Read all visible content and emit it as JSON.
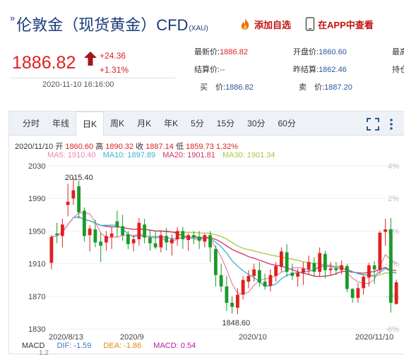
{
  "header": {
    "title": "伦敦金（现货黄金）CFD",
    "title_code": "(XAU)",
    "add_watchlist_label": "添加自选",
    "open_app_label": "在APP中查看"
  },
  "quote": {
    "price": "1886.82",
    "change": "+24.36",
    "change_pct": "+1.31%",
    "datetime": "2020-11-10 16:16:00",
    "fields": [
      {
        "label": "最新价:",
        "value": "1886.82",
        "tone": "red"
      },
      {
        "label": "开盘价:",
        "value": "1860.60",
        "tone": "blue"
      },
      {
        "label": "最高",
        "value": "",
        "tone": "red"
      },
      {
        "label": "结算价:",
        "value": "--",
        "tone": "blue"
      },
      {
        "label": "昨结算:",
        "value": "1862.46",
        "tone": "blue"
      },
      {
        "label": "持仓",
        "value": "",
        "tone": "red"
      },
      {
        "label": "买　价:",
        "value": "1886.82",
        "tone": "blue"
      },
      {
        "label": "卖　价:",
        "value": "1887.20",
        "tone": "blue"
      }
    ]
  },
  "tabs": [
    "分时",
    "年线",
    "日K",
    "周K",
    "月K",
    "年K",
    "5分",
    "15分",
    "30分",
    "60分"
  ],
  "active_tab": "日K",
  "ohlc": {
    "date": "2020/11/10",
    "open_label": "开",
    "open": "1860.60",
    "high_label": "高",
    "high": "1890.32",
    "close_label": "收",
    "close": "1887.14",
    "low_label": "低",
    "low": "1859.73",
    "pct": "1.32%"
  },
  "ma": {
    "ma5": "MA5: 1910.40",
    "ma10": "MA10: 1897.89",
    "ma20": "MA20: 1901.81",
    "ma30": "MA30: 1901.34"
  },
  "macd": {
    "name": "MACD",
    "dif": "DIF: -1.59",
    "dea": "DEA: -1.86",
    "macd": "MACD: 0.54",
    "next_tick": "1.2"
  },
  "colors": {
    "up": "#e02020",
    "down": "#1a9a2a",
    "ma5": "#e88aa8",
    "ma10": "#3ab0d0",
    "ma20": "#d23060",
    "ma30": "#a8c840",
    "title": "#1a3a7a"
  },
  "chart_data": {
    "type": "candlestick",
    "y_ticks": [
      "2030",
      "1990",
      "1950",
      "1910",
      "1870",
      "1830"
    ],
    "y_range": [
      1830,
      2030
    ],
    "pct_ticks": [
      "4%",
      "2%",
      "0%",
      "-2%",
      "-4%",
      "-6%"
    ],
    "x_labels": [
      "2020/8/13",
      "2020/9",
      "2020/10",
      "2020/11/10"
    ],
    "max_label": "2015.40",
    "min_label": "1848.60",
    "candles": [
      {
        "d": "2020-08-13",
        "o": 1911,
        "h": 1945,
        "l": 1903,
        "c": 1943
      },
      {
        "d": "2020-08-14",
        "o": 1947,
        "h": 1960,
        "l": 1935,
        "c": 1945
      },
      {
        "d": "2020-08-17",
        "o": 1944,
        "h": 1965,
        "l": 1930,
        "c": 1958
      },
      {
        "d": "2020-08-18",
        "o": 1982,
        "h": 2008,
        "l": 1968,
        "c": 1986
      },
      {
        "d": "2020-08-19",
        "o": 1990,
        "h": 2015.4,
        "l": 1982,
        "c": 2000
      },
      {
        "d": "2020-08-20",
        "o": 2005,
        "h": 2012,
        "l": 1965,
        "c": 1973
      },
      {
        "d": "2020-08-21",
        "o": 1975,
        "h": 1979,
        "l": 1937,
        "c": 1944
      },
      {
        "d": "2020-08-24",
        "o": 1945,
        "h": 1957,
        "l": 1925,
        "c": 1953
      },
      {
        "d": "2020-08-25",
        "o": 1952,
        "h": 1964,
        "l": 1930,
        "c": 1936
      },
      {
        "d": "2020-08-26",
        "o": 1937,
        "h": 1948,
        "l": 1912,
        "c": 1932
      },
      {
        "d": "2020-08-27",
        "o": 1936,
        "h": 1950,
        "l": 1926,
        "c": 1944
      },
      {
        "d": "2020-08-28",
        "o": 1943,
        "h": 1955,
        "l": 1928,
        "c": 1947
      },
      {
        "d": "2020-08-31",
        "o": 1962,
        "h": 1975,
        "l": 1942,
        "c": 1955
      },
      {
        "d": "2020-09-01",
        "o": 1956,
        "h": 1970,
        "l": 1938,
        "c": 1945
      },
      {
        "d": "2020-09-02",
        "o": 1946,
        "h": 1950,
        "l": 1928,
        "c": 1934
      },
      {
        "d": "2020-09-03",
        "o": 1935,
        "h": 1945,
        "l": 1925,
        "c": 1940
      },
      {
        "d": "2020-09-04",
        "o": 1940,
        "h": 1966,
        "l": 1932,
        "c": 1960
      },
      {
        "d": "2020-09-07",
        "o": 1958,
        "h": 1965,
        "l": 1935,
        "c": 1942
      },
      {
        "d": "2020-09-08",
        "o": 1942,
        "h": 1952,
        "l": 1926,
        "c": 1935
      },
      {
        "d": "2020-09-09",
        "o": 1935,
        "h": 1950,
        "l": 1928,
        "c": 1930
      },
      {
        "d": "2020-09-10",
        "o": 1930,
        "h": 1950,
        "l": 1924,
        "c": 1945
      },
      {
        "d": "2020-09-11",
        "o": 1944,
        "h": 1954,
        "l": 1926,
        "c": 1936
      },
      {
        "d": "2020-09-14",
        "o": 1935,
        "h": 1946,
        "l": 1920,
        "c": 1940
      },
      {
        "d": "2020-09-15",
        "o": 1940,
        "h": 1955,
        "l": 1932,
        "c": 1950
      },
      {
        "d": "2020-09-16",
        "o": 1950,
        "h": 1955,
        "l": 1928,
        "c": 1940
      },
      {
        "d": "2020-09-17",
        "o": 1939,
        "h": 1947,
        "l": 1926,
        "c": 1945
      },
      {
        "d": "2020-09-18",
        "o": 1945,
        "h": 1950,
        "l": 1934,
        "c": 1942
      },
      {
        "d": "2020-09-21",
        "o": 1943,
        "h": 1950,
        "l": 1928,
        "c": 1938
      },
      {
        "d": "2020-09-22",
        "o": 1937,
        "h": 1947,
        "l": 1930,
        "c": 1945
      },
      {
        "d": "2020-09-23",
        "o": 1945,
        "h": 1950,
        "l": 1912,
        "c": 1930
      },
      {
        "d": "2020-09-24",
        "o": 1928,
        "h": 1932,
        "l": 1882,
        "c": 1896
      },
      {
        "d": "2020-09-25",
        "o": 1896,
        "h": 1910,
        "l": 1875,
        "c": 1882
      },
      {
        "d": "2020-09-28",
        "o": 1882,
        "h": 1895,
        "l": 1852,
        "c": 1862
      },
      {
        "d": "2020-09-29",
        "o": 1862,
        "h": 1870,
        "l": 1848.6,
        "c": 1857
      },
      {
        "d": "2020-09-30",
        "o": 1856,
        "h": 1880,
        "l": 1848,
        "c": 1872
      },
      {
        "d": "2020-10-01",
        "o": 1872,
        "h": 1895,
        "l": 1866,
        "c": 1890
      },
      {
        "d": "2020-10-02",
        "o": 1888,
        "h": 1902,
        "l": 1880,
        "c": 1895
      },
      {
        "d": "2020-10-05",
        "o": 1895,
        "h": 1910,
        "l": 1888,
        "c": 1903
      },
      {
        "d": "2020-10-06",
        "o": 1902,
        "h": 1912,
        "l": 1882,
        "c": 1887
      },
      {
        "d": "2020-10-07",
        "o": 1888,
        "h": 1898,
        "l": 1878,
        "c": 1882
      },
      {
        "d": "2020-10-08",
        "o": 1883,
        "h": 1903,
        "l": 1876,
        "c": 1896
      },
      {
        "d": "2020-10-09",
        "o": 1895,
        "h": 1912,
        "l": 1888,
        "c": 1907
      },
      {
        "d": "2020-10-12",
        "o": 1906,
        "h": 1930,
        "l": 1900,
        "c": 1925
      },
      {
        "d": "2020-10-13",
        "o": 1924,
        "h": 1934,
        "l": 1894,
        "c": 1900
      },
      {
        "d": "2020-10-14",
        "o": 1899,
        "h": 1910,
        "l": 1890,
        "c": 1895
      },
      {
        "d": "2020-10-15",
        "o": 1894,
        "h": 1904,
        "l": 1882,
        "c": 1899
      },
      {
        "d": "2020-10-16",
        "o": 1899,
        "h": 1912,
        "l": 1884,
        "c": 1904
      },
      {
        "d": "2020-10-19",
        "o": 1903,
        "h": 1920,
        "l": 1896,
        "c": 1912
      },
      {
        "d": "2020-10-20",
        "o": 1911,
        "h": 1918,
        "l": 1895,
        "c": 1900
      },
      {
        "d": "2020-10-21",
        "o": 1900,
        "h": 1930,
        "l": 1894,
        "c": 1923
      },
      {
        "d": "2020-10-22",
        "o": 1922,
        "h": 1926,
        "l": 1892,
        "c": 1902
      },
      {
        "d": "2020-10-23",
        "o": 1902,
        "h": 1912,
        "l": 1896,
        "c": 1904
      },
      {
        "d": "2020-10-26",
        "o": 1904,
        "h": 1912,
        "l": 1896,
        "c": 1902
      },
      {
        "d": "2020-10-27",
        "o": 1902,
        "h": 1914,
        "l": 1897,
        "c": 1908
      },
      {
        "d": "2020-10-28",
        "o": 1907,
        "h": 1910,
        "l": 1875,
        "c": 1879
      },
      {
        "d": "2020-10-29",
        "o": 1879,
        "h": 1880,
        "l": 1862,
        "c": 1868
      },
      {
        "d": "2020-10-30",
        "o": 1868,
        "h": 1886,
        "l": 1862,
        "c": 1880
      },
      {
        "d": "2020-11-02",
        "o": 1880,
        "h": 1895,
        "l": 1872,
        "c": 1894
      },
      {
        "d": "2020-11-03",
        "o": 1893,
        "h": 1911,
        "l": 1882,
        "c": 1908
      },
      {
        "d": "2020-11-04",
        "o": 1908,
        "h": 1913,
        "l": 1885,
        "c": 1903
      },
      {
        "d": "2020-11-05",
        "o": 1902,
        "h": 1950,
        "l": 1898,
        "c": 1948
      },
      {
        "d": "2020-11-06",
        "o": 1949,
        "h": 1965,
        "l": 1932,
        "c": 1952
      },
      {
        "d": "2020-11-09",
        "o": 1952,
        "h": 1966,
        "l": 1850,
        "c": 1862
      },
      {
        "d": "2020-11-10",
        "o": 1860.6,
        "h": 1890.32,
        "l": 1859.73,
        "c": 1887.14
      }
    ]
  }
}
